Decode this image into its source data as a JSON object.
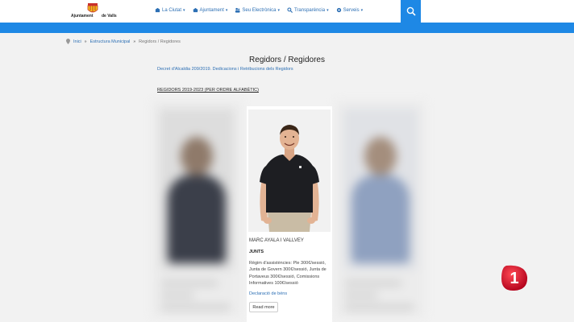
{
  "header": {
    "logo_line1": "Ajuntament",
    "logo_line2": "de Valls",
    "nav": [
      {
        "label": "La Ciutat",
        "icon": "city-icon"
      },
      {
        "label": "Ajuntament",
        "icon": "town-hall-icon"
      },
      {
        "label": "Seu Electrònica",
        "icon": "users-icon"
      },
      {
        "label": "Transparència",
        "icon": "magnifier-icon"
      },
      {
        "label": "Serveis",
        "icon": "services-icon"
      }
    ],
    "search_icon": "search-icon"
  },
  "breadcrumb": {
    "home": "Inici",
    "level1": "Estructura Municipal",
    "current": "Regidors / Regidores"
  },
  "page": {
    "title": "Regidors / Regidores",
    "link1": "Decret d'Alcaldia 209/2019",
    "link2": "Dedicacions i Retribucions dels Regidors",
    "section": "REGIDORS 2019-2023 (PER ORDRE ALFABÈTIC)"
  },
  "card": {
    "name": "MARC AYALA I VALLVEY",
    "party": "JUNTS",
    "description": "Règim d'assistències: Ple 300€/sessió, Junta de Govern 300€/sessió, Junta de Portaveus 300€/sessió, Comissions Informatives 100€/sessió",
    "declaration": "Declaració de béns",
    "more_button": "Read more"
  },
  "overlay": {
    "channel_number": "1",
    "brand_color": "#d6001c"
  },
  "colors": {
    "accent": "#1e88e5",
    "link": "#2c6fb4"
  }
}
